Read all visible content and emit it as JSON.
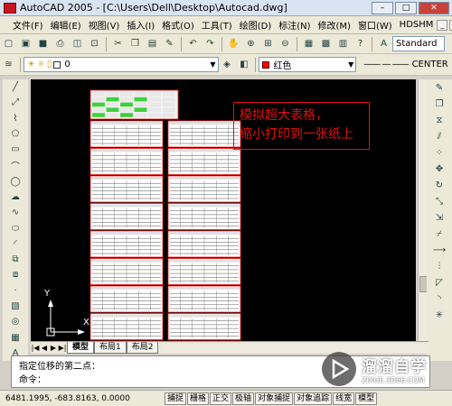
{
  "window": {
    "title": "AutoCAD 2005 - [C:\\Users\\Dell\\Desktop\\Autocad.dwg]",
    "minimize": "–",
    "maximize": "□",
    "close": "✕"
  },
  "menu": {
    "items": [
      "文件(F)",
      "编辑(E)",
      "视图(V)",
      "插入(I)",
      "格式(O)",
      "工具(T)",
      "绘图(D)",
      "标注(N)",
      "修改(M)",
      "窗口(W)",
      "HDSHM"
    ],
    "doc_controls": [
      "_",
      "□",
      "×"
    ]
  },
  "toolbar": {
    "text_style": "Standard"
  },
  "layers": {
    "current_layer": "0",
    "color": "红色",
    "linetype": "CENTER",
    "color_hex": "#ff0000"
  },
  "layout_tabs": [
    "模型",
    "布局1",
    "布局2"
  ],
  "command": {
    "line1": "指定位移的第二点：",
    "line2": "命令："
  },
  "status": {
    "coords": "6481.1995, -683.8163, 0.0000",
    "buttons": [
      "捕捉",
      "栅格",
      "正交",
      "极轴",
      "对象捕捉",
      "对象追踪",
      "线宽",
      "模型"
    ]
  },
  "annotation": {
    "line1": "模拟超大表格，",
    "line2": "缩小打印到一张纸上"
  },
  "watermark": {
    "brand": "溜溜自学",
    "url": "ZIXUE.3D66.COM"
  },
  "ucs": {
    "x_label": "X",
    "y_label": "Y"
  },
  "drawing": {
    "grid_columns": 2,
    "blocks": 19,
    "header_color": "#e0e0e0",
    "border_color": "#ff2020",
    "accent_color": "#40d040"
  }
}
